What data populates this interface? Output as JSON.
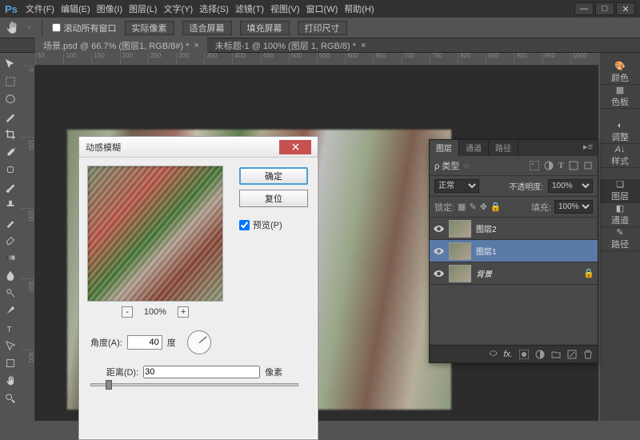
{
  "app": {
    "logo": "Ps"
  },
  "menu": {
    "file": "文件(F)",
    "edit": "编辑(E)",
    "image": "图像(I)",
    "layer": "图层(L)",
    "type": "文字(Y)",
    "select": "选择(S)",
    "filter": "滤镜(T)",
    "view": "视图(V)",
    "window": "窗口(W)",
    "help": "帮助(H)"
  },
  "options": {
    "scroll_all": "滚动所有窗口",
    "actual_pixels": "实际像素",
    "fit_screen": "适合屏幕",
    "fill_screen": "填充屏幕",
    "print_size": "打印尺寸"
  },
  "tabs": {
    "tab1": "场景.psd @ 66.7% (图层1, RGB/8#) *",
    "tab2": "未标题-1 @ 100% (图层 1, RGB/8) *"
  },
  "ruler_h": [
    "50",
    "100",
    "150",
    "200",
    "250",
    "300",
    "350",
    "400",
    "450",
    "500",
    "550",
    "600",
    "650",
    "700",
    "750",
    "800",
    "850",
    "900",
    "950",
    "1000"
  ],
  "ruler_v": [
    "0",
    "100",
    "200",
    "300",
    "400"
  ],
  "panels_r": {
    "color": "颜色",
    "swatches": "色板",
    "adjust": "调整",
    "styles": "样式",
    "layers": "图层",
    "channels": "通道",
    "paths": "路径"
  },
  "dialog": {
    "title": "动感模糊",
    "ok": "确定",
    "reset": "复位",
    "preview": "预览(P)",
    "zoom": "100%",
    "angle_label": "角度(A):",
    "angle_value": "40",
    "angle_unit": "度",
    "distance_label": "距离(D):",
    "distance_value": "30",
    "distance_unit": "像素"
  },
  "layers": {
    "tab_layers": "图层",
    "tab_channels": "通道",
    "tab_paths": "路径",
    "kind_label": "ρ 类型",
    "blend": "正常",
    "opacity_label": "不透明度:",
    "opacity": "100%",
    "lock_label": "锁定:",
    "fill_label": "填充:",
    "fill": "100%",
    "items": [
      {
        "name": "图层2"
      },
      {
        "name": "图层1"
      },
      {
        "name": "背景"
      }
    ]
  }
}
